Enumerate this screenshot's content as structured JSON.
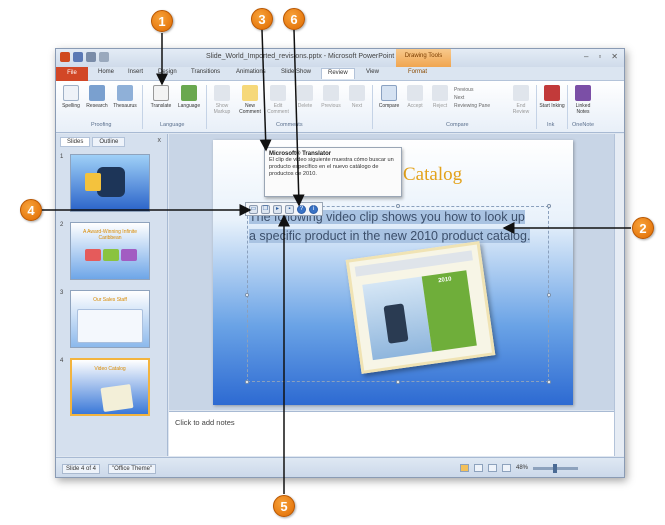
{
  "window": {
    "doc_title": "Slide_World_Imported_revisions.pptx - Microsoft PowerPoint",
    "tools_context": "Drawing Tools",
    "buttons": [
      "–",
      "▫",
      "✕"
    ]
  },
  "tabs": [
    "File",
    "Home",
    "Insert",
    "Design",
    "Transitions",
    "Animations",
    "Slide Show",
    "Review",
    "View",
    "Format"
  ],
  "ribbon": {
    "spelling": "Spelling",
    "research": "Research",
    "thesaurus": "Thesaurus",
    "translate": "Translate",
    "language": "Language",
    "show_markup": "Show Markup",
    "new_comment": "New Comment",
    "edit_comment": "Edit Comment",
    "delete": "Delete",
    "previous": "Previous",
    "next": "Next",
    "compare": "Compare",
    "accept": "Accept",
    "reject": "Reject",
    "compare_list": [
      "Previous",
      "Next",
      "Reviewing Pane"
    ],
    "end_review": "End Review",
    "start_inking": "Start Inking",
    "linked_notes": "Linked Notes",
    "groups": [
      "Proofing",
      "Language",
      "Comments",
      "Compare",
      "Ink",
      "OneNote"
    ]
  },
  "pane": {
    "tabs": [
      "Slides",
      "Outline"
    ],
    "close": "x",
    "thumbs": [
      {
        "num": "1",
        "title": ""
      },
      {
        "num": "2",
        "title": "A Award-Winning Infinite Caribbean"
      },
      {
        "num": "3",
        "title": "Our Sales Staff"
      },
      {
        "num": "4",
        "title": "Video Catalog"
      }
    ]
  },
  "slide": {
    "title": "Catalog",
    "body_text": "The following video clip shows you how to look up a specific product in the new 2010 product catalog.",
    "picture_label": "2010"
  },
  "translator": {
    "title": "Microsoft® Translator",
    "text": "El clip de video siguiente muestra cómo buscar un producto específico en el nuevo catálogo de productos de 2010."
  },
  "notes": {
    "placeholder": "Click to add notes"
  },
  "status": {
    "slide": "Slide 4 of 4",
    "theme": "\"Office Theme\"",
    "zoom": "48%"
  },
  "callouts": [
    "1",
    "2",
    "3",
    "4",
    "5",
    "6"
  ],
  "colors": {
    "callout": "#e8790a",
    "ribbon_active_tab": "#ffffff",
    "slide_title": "#e3a21a"
  }
}
